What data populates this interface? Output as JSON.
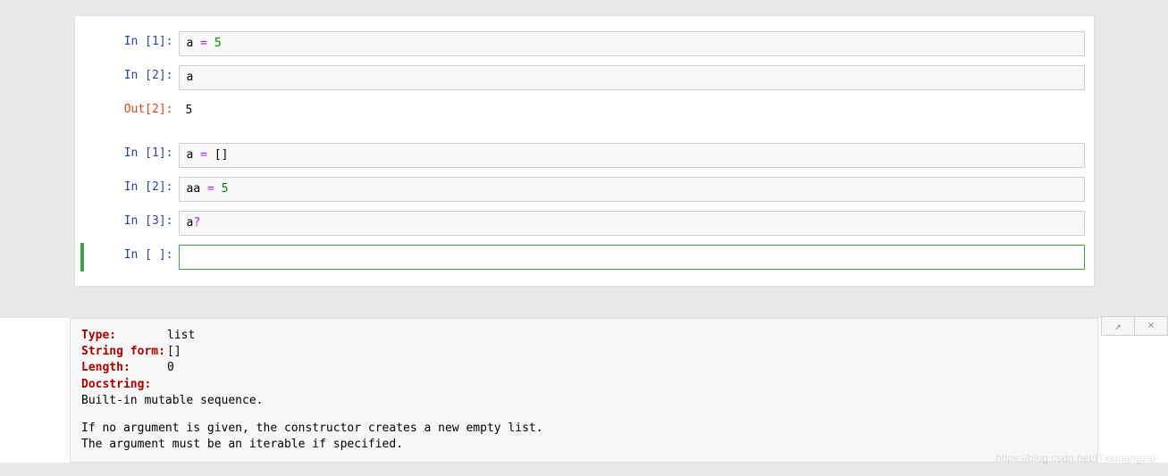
{
  "cells": {
    "c1": {
      "prompt": "In  [1]:",
      "var": "a",
      "op": "=",
      "val": "5"
    },
    "c2": {
      "prompt": "In  [2]:",
      "content": "a"
    },
    "o2": {
      "prompt": "Out[2]:",
      "value": "5"
    },
    "c3": {
      "prompt": "In  [1]:",
      "var": "a",
      "op": "=",
      "brackets": "[]"
    },
    "c4": {
      "prompt": "In  [2]:",
      "var": "aa",
      "op": "=",
      "val": "5"
    },
    "c5": {
      "prompt": "In  [3]:",
      "var": "a",
      "qmark": "?"
    },
    "c6": {
      "prompt": "In  [ ]:",
      "content": ""
    }
  },
  "info": {
    "labels": {
      "type": "Type:",
      "string_form": "String form:",
      "length": "Length:",
      "docstring": "Docstring:"
    },
    "values": {
      "type": "list",
      "string_form": "[]",
      "length": "0"
    },
    "doc": {
      "line1": "Built-in mutable sequence.",
      "line2": "If no argument is given, the constructor creates a new empty list.",
      "line3": "The argument must be an iterable if specified."
    }
  },
  "watermark": "https://blog.csdn.net/ITxiaoangzai",
  "icons": {
    "expand": "↗",
    "close": "×"
  }
}
